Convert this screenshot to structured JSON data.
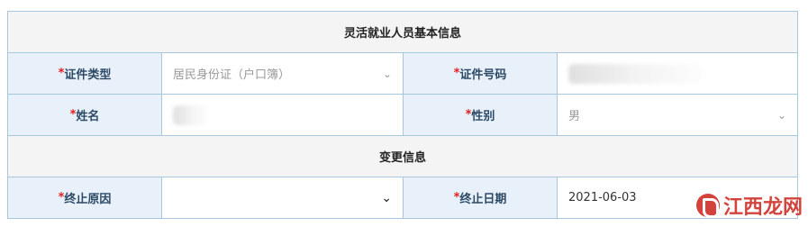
{
  "section1": {
    "title": "灵活就业人员基本信息"
  },
  "fields": {
    "id_type": {
      "label": "证件类型",
      "value": "居民身份证（户口簿）",
      "chevron": "chevron-down-icon"
    },
    "id_number": {
      "label": "证件号码",
      "value": ""
    },
    "name": {
      "label": "姓名",
      "value": ""
    },
    "gender": {
      "label": "性别",
      "value": "男",
      "chevron": "chevron-down-icon"
    }
  },
  "section2": {
    "title": "变更信息"
  },
  "change": {
    "reason": {
      "label": "终止原因",
      "value": "",
      "chevron": "chevron-down-icon"
    },
    "date": {
      "label": "终止日期",
      "value": "2021-06-03"
    }
  },
  "required_mark": "*",
  "watermark": {
    "text": "江西龙网"
  },
  "colors": {
    "label_bg": "#e8f1fa",
    "label_text": "#2d4a66",
    "required": "#e02020",
    "border": "#a8c6dc",
    "section_bg": "#f4f4f4"
  }
}
